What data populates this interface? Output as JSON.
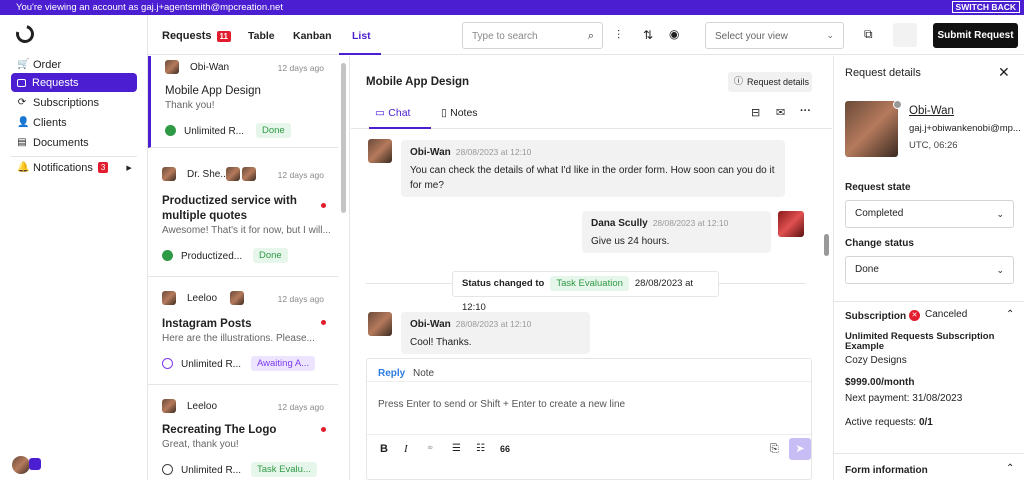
{
  "banner": {
    "text": "You're viewing an account as gaj.j+agentsmith@mpcreation.net",
    "switch_label": "SWITCH BACK"
  },
  "sidebar": {
    "items": [
      {
        "label": "Order",
        "icon": "cart-icon"
      },
      {
        "label": "Requests",
        "icon": "inbox-icon"
      },
      {
        "label": "Subscriptions",
        "icon": "refresh-icon"
      },
      {
        "label": "Clients",
        "icon": "user-icon"
      },
      {
        "label": "Documents",
        "icon": "document-icon"
      }
    ],
    "notifications": {
      "label": "Notifications",
      "count": "3"
    }
  },
  "header": {
    "title": "Requests",
    "count": "11",
    "tabs": [
      "Table",
      "Kanban",
      "List"
    ],
    "active_tab": "List",
    "search_placeholder": "Type to search",
    "view_placeholder": "Select your view",
    "submit_label": "Submit Request"
  },
  "requests": [
    {
      "name": "Obi-Wan",
      "time": "12 days ago",
      "title": "Mobile App Design",
      "preview": "Thank you!",
      "type": "Unlimited R...",
      "status": "Done",
      "status_color": "green"
    },
    {
      "name": "Dr. She...",
      "time": "12 days ago",
      "title": "Productized service with multiple quotes",
      "preview": "Awesome! That's it for now, but I will...",
      "type": "Productized...",
      "status": "Done",
      "status_color": "green"
    },
    {
      "name": "Leeloo",
      "time": "12 days ago",
      "title": "Instagram Posts",
      "preview": "Here are the illustrations. Please...",
      "type": "Unlimited R...",
      "status": "Awaiting A...",
      "status_color": "purple"
    },
    {
      "name": "Leeloo",
      "time": "12 days ago",
      "title": "Recreating The Logo",
      "preview": "Great, thank you!",
      "type": "Unlimited R...",
      "status": "Task Evalu...",
      "status_color": "green"
    }
  ],
  "chat": {
    "title": "Mobile App Design",
    "details_label": "Request details",
    "tabs": [
      "Chat",
      "Notes"
    ],
    "messages": [
      {
        "name": "Obi-Wan",
        "date": "28/08/2023 at 12:10",
        "text": "You can check the details of what I'd like in the order form. How soon can you do it for me?"
      },
      {
        "name": "Dana Scully",
        "date": "28/08/2023 at 12:10",
        "text": "Give us 24 hours."
      },
      {
        "name": "Obi-Wan",
        "date": "28/08/2023 at 12:10",
        "text": "Cool! Thanks."
      }
    ],
    "status_change": {
      "label": "Status changed to",
      "status": "Task Evaluation",
      "date": "28/08/2023 at 12:10"
    },
    "composer": {
      "tabs": [
        "Reply",
        "Note"
      ],
      "placeholder": "Press Enter to send or Shift + Enter to create a new line"
    }
  },
  "details": {
    "title": "Request details",
    "client_name": "Obi-Wan",
    "client_email": "gaj.j+obiwankenobi@mp...",
    "client_time": "UTC, 06:26",
    "state_label": "Request state",
    "state_value": "Completed",
    "change_label": "Change status",
    "change_value": "Done",
    "subscription_label": "Subscription",
    "subscription_status": "Canceled",
    "sub_name": "Unlimited Requests Subscription Example",
    "company": "Cozy Designs",
    "price": "$999.00/month",
    "next_payment": "Next payment: 31/08/2023",
    "active_label": "Active requests:",
    "active_value": "0/1",
    "form_label": "Form information"
  }
}
